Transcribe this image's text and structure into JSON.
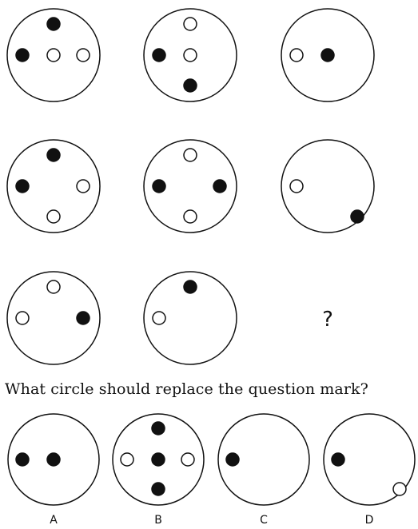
{
  "question": "What circle should replace the question mark?",
  "missing_marker": "?",
  "colors": {
    "stroke": "#111111",
    "filled_dot": "#111111",
    "empty_dot": "#ffffff",
    "background": "#ffffff"
  },
  "grid": {
    "rows": [
      [
        {
          "dots": [
            {
              "pos": "top",
              "fill": "filled"
            },
            {
              "pos": "left",
              "fill": "filled"
            },
            {
              "pos": "center",
              "fill": "empty"
            },
            {
              "pos": "right",
              "fill": "empty"
            }
          ]
        },
        {
          "dots": [
            {
              "pos": "top",
              "fill": "empty"
            },
            {
              "pos": "left",
              "fill": "filled"
            },
            {
              "pos": "center",
              "fill": "empty"
            },
            {
              "pos": "bottom",
              "fill": "filled"
            }
          ]
        },
        {
          "dots": [
            {
              "pos": "left",
              "fill": "empty"
            },
            {
              "pos": "center",
              "fill": "filled"
            }
          ]
        }
      ],
      [
        {
          "dots": [
            {
              "pos": "top",
              "fill": "filled"
            },
            {
              "pos": "left",
              "fill": "filled"
            },
            {
              "pos": "right",
              "fill": "empty"
            },
            {
              "pos": "bottom",
              "fill": "empty"
            }
          ]
        },
        {
          "dots": [
            {
              "pos": "top",
              "fill": "empty"
            },
            {
              "pos": "left",
              "fill": "filled"
            },
            {
              "pos": "right",
              "fill": "filled"
            },
            {
              "pos": "bottom",
              "fill": "empty"
            }
          ]
        },
        {
          "dots": [
            {
              "pos": "left",
              "fill": "empty"
            },
            {
              "pos": "bottom-right",
              "fill": "filled"
            }
          ]
        }
      ],
      [
        {
          "dots": [
            {
              "pos": "top",
              "fill": "empty"
            },
            {
              "pos": "left",
              "fill": "empty"
            },
            {
              "pos": "right",
              "fill": "filled"
            }
          ]
        },
        {
          "dots": [
            {
              "pos": "top",
              "fill": "filled"
            },
            {
              "pos": "left",
              "fill": "empty"
            }
          ]
        },
        null
      ]
    ]
  },
  "options": [
    {
      "label": "A",
      "dots": [
        {
          "pos": "left",
          "fill": "filled"
        },
        {
          "pos": "center",
          "fill": "filled"
        }
      ]
    },
    {
      "label": "B",
      "dots": [
        {
          "pos": "top",
          "fill": "filled"
        },
        {
          "pos": "left",
          "fill": "empty"
        },
        {
          "pos": "center",
          "fill": "filled"
        },
        {
          "pos": "right",
          "fill": "empty"
        },
        {
          "pos": "bottom",
          "fill": "filled"
        }
      ]
    },
    {
      "label": "C",
      "dots": [
        {
          "pos": "left",
          "fill": "filled"
        }
      ]
    },
    {
      "label": "D",
      "dots": [
        {
          "pos": "left",
          "fill": "filled"
        },
        {
          "pos": "bottom-right",
          "fill": "empty"
        }
      ]
    }
  ]
}
